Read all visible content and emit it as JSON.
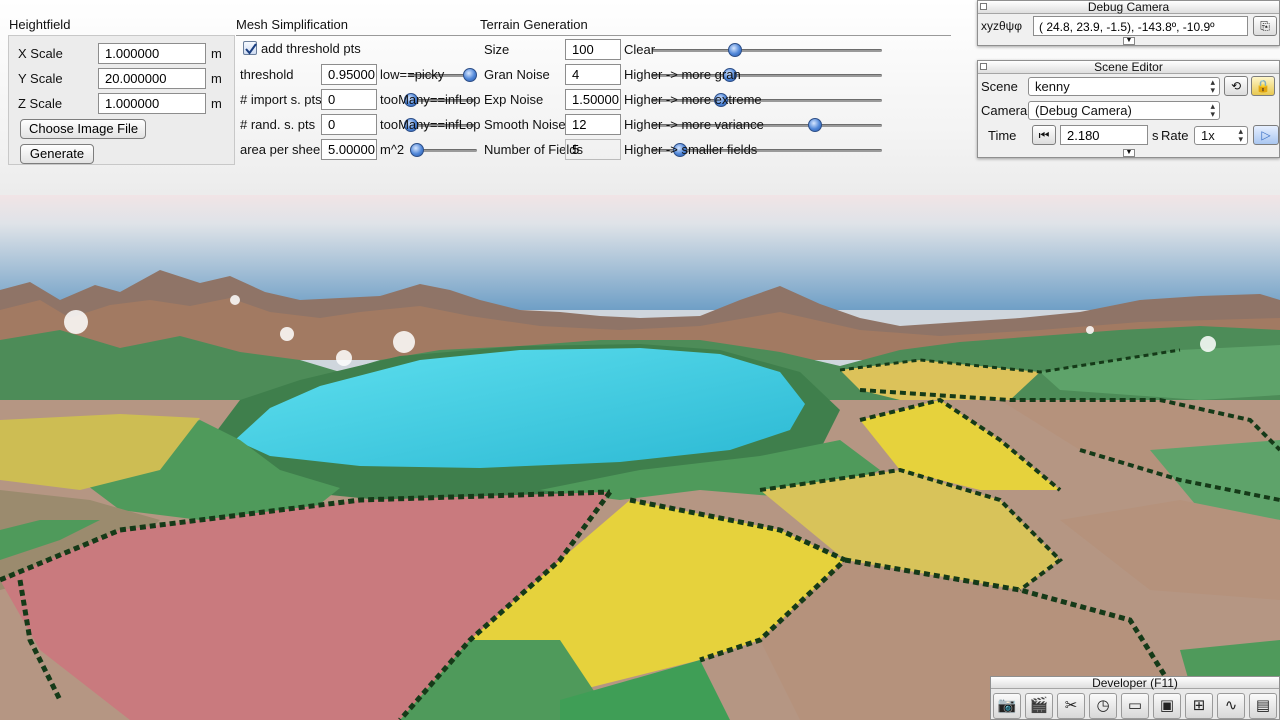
{
  "heightfield": {
    "title": "Heightfield",
    "x_scale": {
      "label": "X Scale",
      "value": "1.000000",
      "unit": "m"
    },
    "y_scale": {
      "label": "Y Scale",
      "value": "20.000000",
      "unit": "m"
    },
    "z_scale": {
      "label": "Z Scale",
      "value": "1.000000",
      "unit": "m"
    },
    "choose_image_label": "Choose Image File",
    "generate_label": "Generate"
  },
  "mesh": {
    "title": "Mesh Simplification",
    "add_threshold": {
      "label": "add threshold pts",
      "checked": true
    },
    "threshold": {
      "label": "threshold",
      "value": "0.95000",
      "note": "low==picky",
      "slider": 0.92
    },
    "import_pts": {
      "label": "# import s. pts",
      "value": "0",
      "note": "tooMany==infLop",
      "slider": 0.04
    },
    "rand_pts": {
      "label": "# rand. s. pts",
      "value": "0",
      "note": "tooMany==infLop",
      "slider": 0.04
    },
    "area_sheep": {
      "label": "area per sheep",
      "value": "5.00000",
      "note": "m^2",
      "slider": 0.05
    }
  },
  "terrain": {
    "title": "Terrain Generation",
    "size": {
      "label": "Size",
      "value": "100",
      "note": "Clear",
      "slider": 0.36
    },
    "gran_noise": {
      "label": "Gran Noise",
      "value": "4",
      "note": "Higher -> more gran",
      "slider": 0.34
    },
    "exp_noise": {
      "label": "Exp Noise",
      "value": "1.50000",
      "note": "Higher -> more extreme",
      "slider": 0.3
    },
    "smooth_noise": {
      "label": "Smooth Noise",
      "value": "12",
      "note": "Higher -> more variance",
      "slider": 0.71
    },
    "num_fields": {
      "label": "Number of Fields",
      "value": "5",
      "note": "Higher -> smaller fields",
      "slider": 0.12
    }
  },
  "debug_camera": {
    "title": "Debug Camera",
    "label": "xyzθψφ",
    "value": "( 24.8,  23.9,  -1.5), -143.8º, -10.9º"
  },
  "scene_editor": {
    "title": "Scene Editor",
    "scene_label": "Scene",
    "scene_value": "kenny",
    "camera_label": "Camera",
    "camera_value": "(Debug Camera)",
    "time_label": "Time",
    "time_value": "2.180",
    "time_unit": "s",
    "rate_label": "Rate",
    "rate_value": "1x"
  },
  "developer": {
    "title": "Developer (F11)",
    "icons": [
      "camera-icon",
      "clapperboard-icon",
      "tools-icon",
      "clock-icon",
      "window-icon",
      "terminal-icon",
      "scene-graph-icon",
      "profiler-icon",
      "document-icon"
    ]
  },
  "colors": {
    "accent": "#4f86d8",
    "lake": "#3fd4e8",
    "field_red": "#c97a7e",
    "field_yellow": "#e6d23c",
    "grass": "#4f9a5b",
    "soil": "#b5927c"
  }
}
